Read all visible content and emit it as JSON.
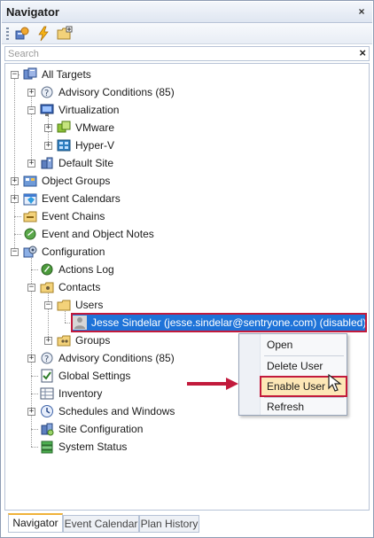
{
  "window": {
    "title": "Navigator",
    "close_glyph": "×"
  },
  "toolbar": {
    "icons": [
      "refresh-targets-icon",
      "lightning-icon",
      "new-folder-icon"
    ]
  },
  "search": {
    "placeholder": "Search",
    "value": "",
    "clear_glyph": "×"
  },
  "tree": {
    "all_targets": "All Targets",
    "advisory_conditions_top": "Advisory Conditions (85)",
    "virtualization": "Virtualization",
    "vmware": "VMware",
    "hyperv": "Hyper-V",
    "default_site": "Default Site",
    "object_groups": "Object Groups",
    "event_calendars": "Event Calendars",
    "event_chains": "Event Chains",
    "event_object_notes": "Event and Object Notes",
    "configuration": "Configuration",
    "actions_log": "Actions Log",
    "contacts": "Contacts",
    "users": "Users",
    "selected_user": "Jesse Sindelar (jesse.sindelar@sentryone.com) (disabled)",
    "groups": "Groups",
    "advisory_conditions_cfg": "Advisory Conditions (85)",
    "global_settings": "Global Settings",
    "inventory": "Inventory",
    "schedules_windows": "Schedules and Windows",
    "site_configuration": "Site Configuration",
    "system_status": "System Status"
  },
  "context_menu": {
    "open": "Open",
    "delete_user": "Delete User",
    "enable_user": "Enable User",
    "refresh": "Refresh"
  },
  "tabs": [
    {
      "label": "Navigator",
      "active": true
    },
    {
      "label": "Event Calendar",
      "active": false
    },
    {
      "label": "Plan History",
      "active": false
    }
  ],
  "colors": {
    "selection": "#1e73d8",
    "highlight_outline": "#c21a3c",
    "menu_hover": "#fde7b6",
    "active_tab_accent": "#f0b23a"
  }
}
